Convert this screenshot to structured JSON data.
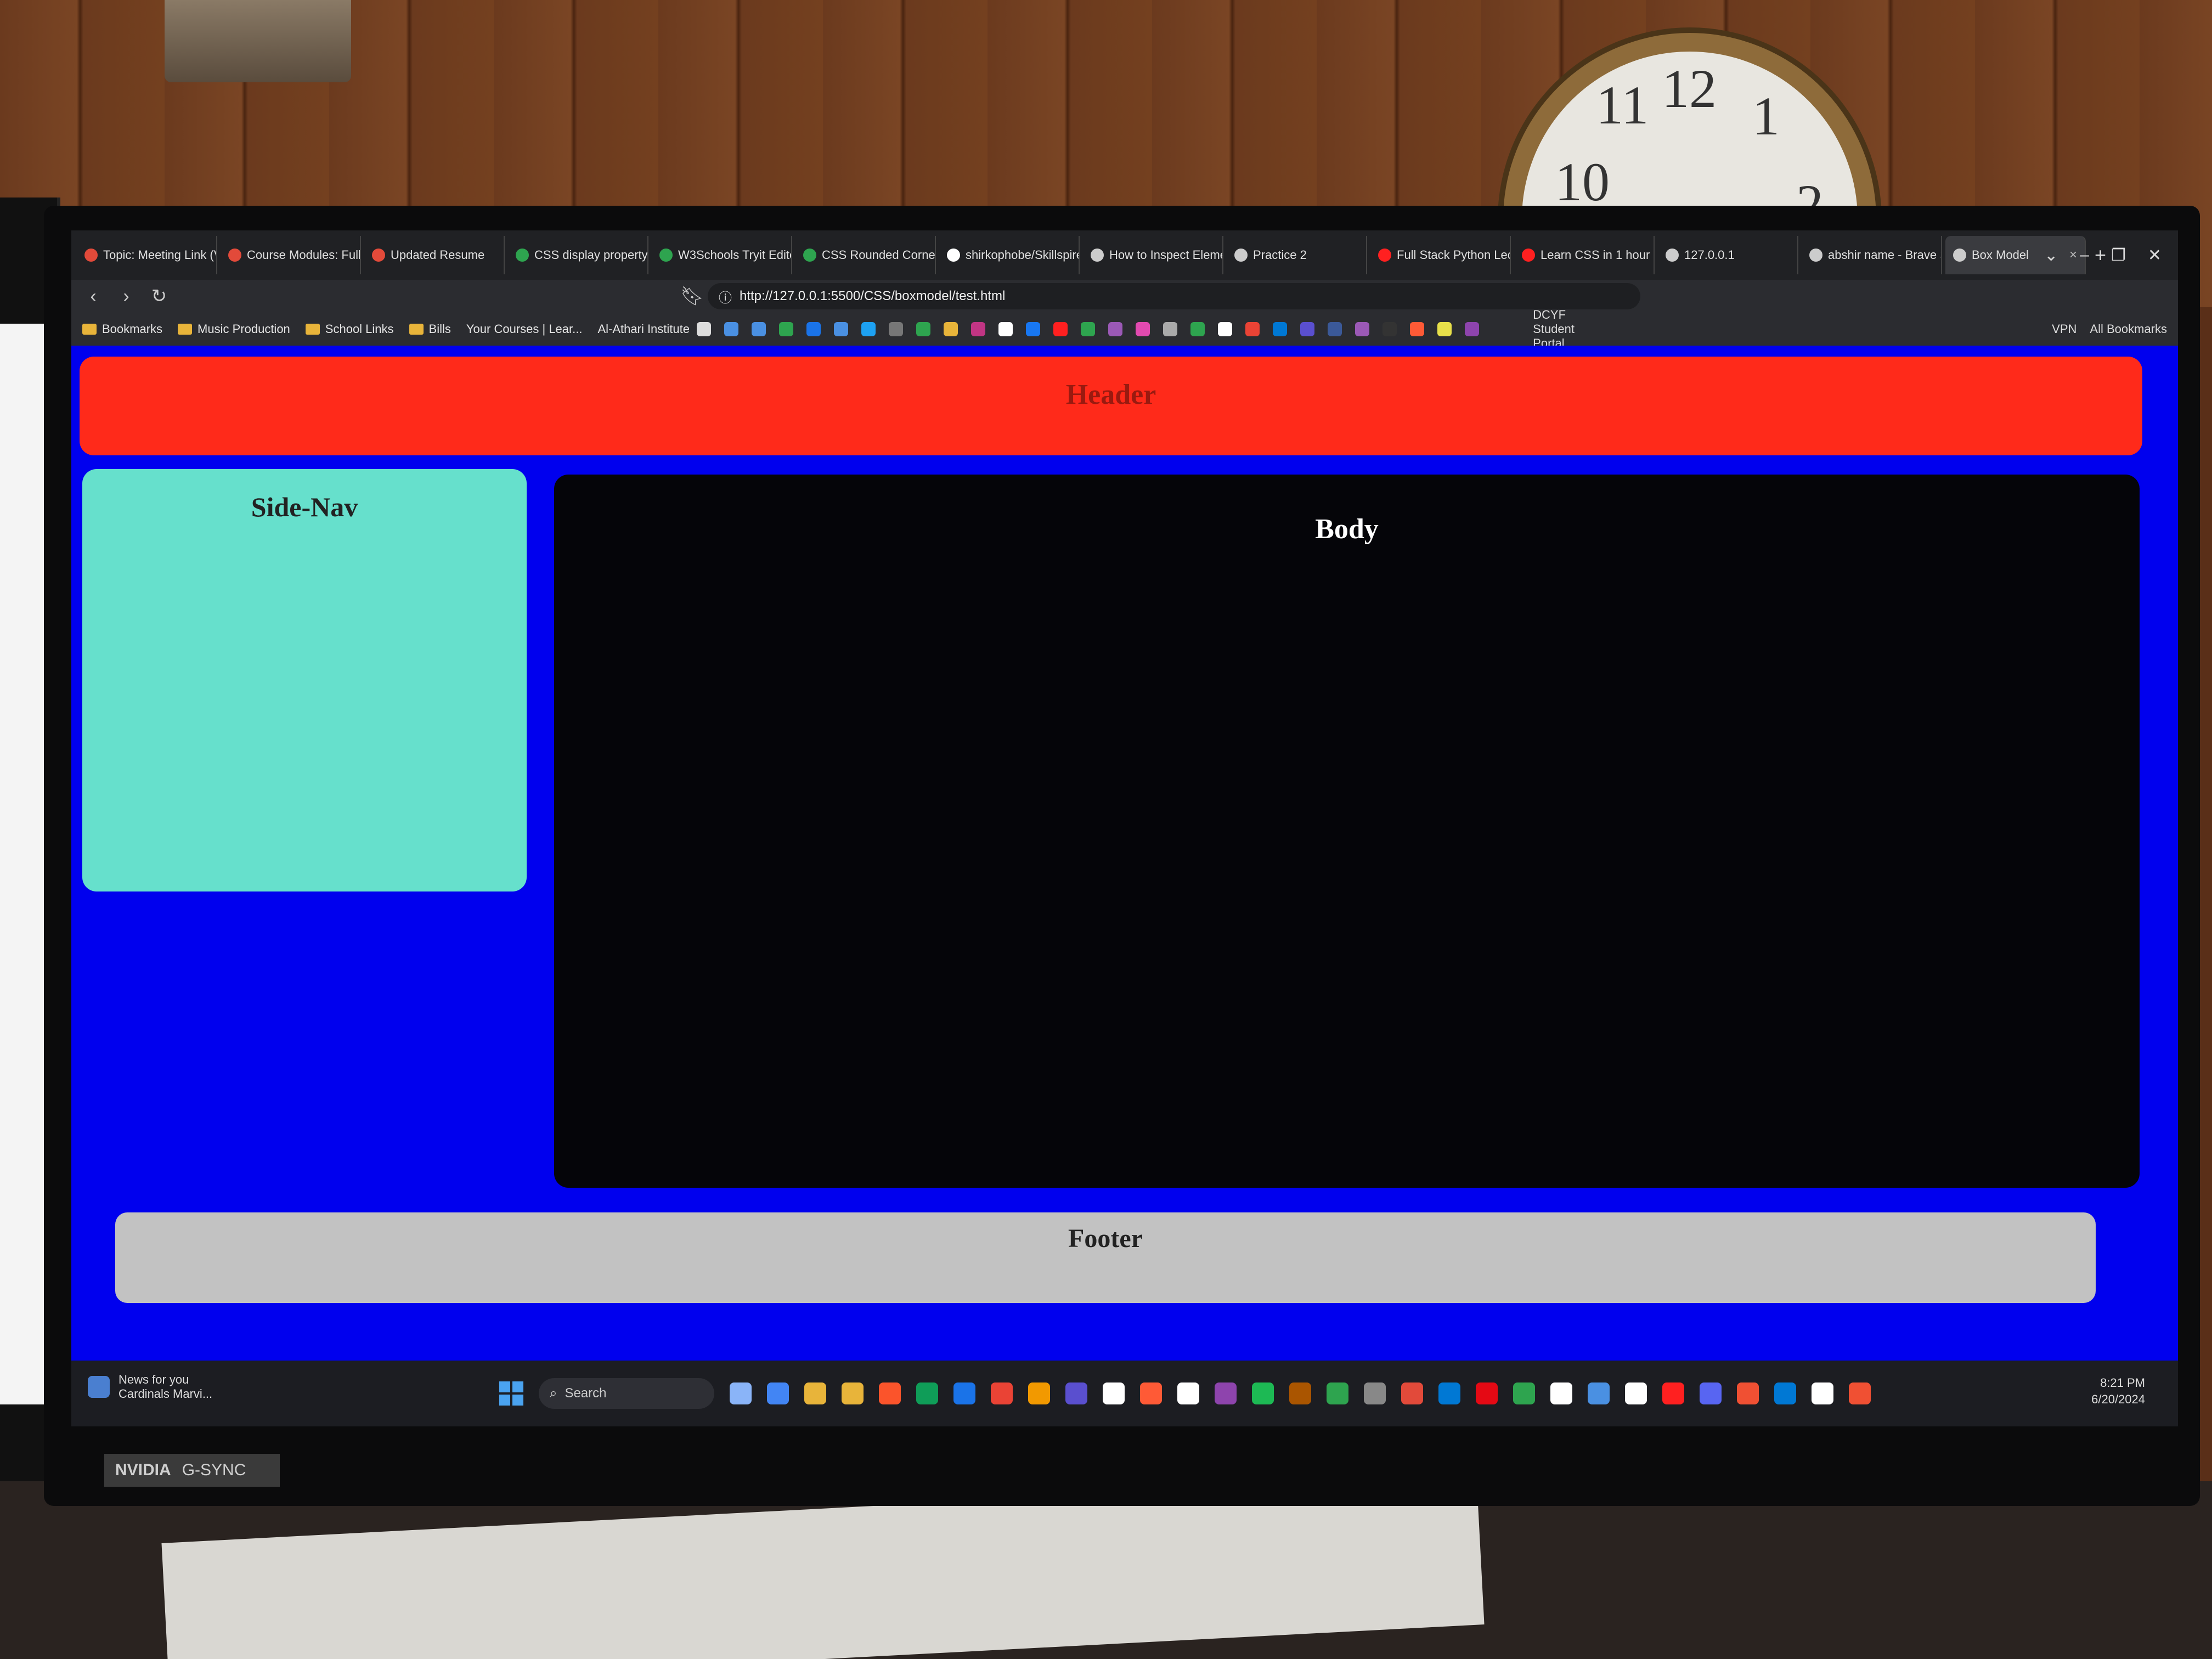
{
  "browser": {
    "tabs": [
      {
        "label": "Topic: Meeting Link (V",
        "icon": "circle-icon",
        "color": "#e24a3a"
      },
      {
        "label": "Course Modules: Full S",
        "icon": "circle-icon",
        "color": "#e24a3a"
      },
      {
        "label": "Updated Resume",
        "icon": "circle-icon",
        "color": "#e24a3a"
      },
      {
        "label": "CSS display property",
        "icon": "w3schools-icon",
        "color": "#2ea44f"
      },
      {
        "label": "W3Schools Tryit Editor",
        "icon": "w3schools-icon",
        "color": "#2ea44f"
      },
      {
        "label": "CSS Rounded Corners",
        "icon": "w3schools-icon",
        "color": "#2ea44f"
      },
      {
        "label": "shirkophobe/Skillspire",
        "icon": "github-icon",
        "color": "#ffffff"
      },
      {
        "label": "How to Inspect Elemen",
        "icon": "globe-icon",
        "color": "#cccccc"
      },
      {
        "label": "Practice 2",
        "icon": "globe-icon",
        "color": "#cccccc"
      },
      {
        "label": "Full Stack Python Lectu",
        "icon": "youtube-icon",
        "color": "#ff2020"
      },
      {
        "label": "Learn CSS in 1 hour",
        "icon": "youtube-icon",
        "color": "#ff2020"
      },
      {
        "label": "127.0.0.1",
        "icon": "globe-icon",
        "color": "#cccccc"
      },
      {
        "label": "abshir name - Brave S",
        "icon": "search-icon",
        "color": "#cccccc"
      },
      {
        "label": "Box Model",
        "icon": "globe-icon",
        "color": "#cccccc",
        "active": true
      }
    ],
    "new_tab": "+",
    "url": "http://127.0.0.1:5500/CSS/boxmodel/test.html",
    "bookmarks": [
      "Bookmarks",
      "Music Production",
      "School Links",
      "Bills",
      "Your Courses | Lear...",
      "Al-Athari Institute"
    ],
    "extension_bookmark": "DCYF Student Portal",
    "all_bookmarks": "All Bookmarks",
    "vpn_label": "VPN"
  },
  "page": {
    "header": "Header",
    "sidenav": "Side-Nav",
    "body": "Body",
    "footer": "Footer",
    "colors": {
      "background": "#0000ee",
      "header": "#ff2a1a",
      "sidenav": "#66e0cc",
      "body": "#050509",
      "footer": "#c2c2c2"
    }
  },
  "taskbar": {
    "news_title": "News for you",
    "news_sub": "Cardinals Marvi...",
    "search_placeholder": "Search",
    "time": "8:21 PM",
    "date": "6/20/2024"
  },
  "hardware": {
    "brand": "NVIDIA",
    "badge": "G-SYNC"
  }
}
